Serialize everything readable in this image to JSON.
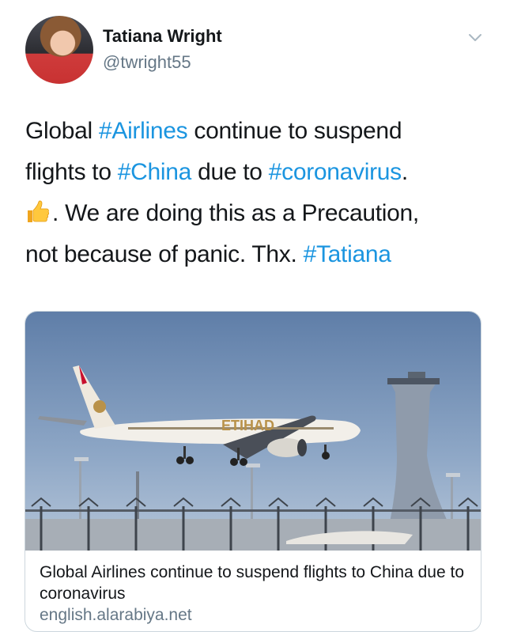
{
  "author": {
    "name": "Tatiana Wright",
    "handle": "@twright55"
  },
  "tweet": {
    "line1": {
      "a": "Global ",
      "tag1": "#Airlines",
      "b": " continue to suspend"
    },
    "line2": {
      "a": "flights to ",
      "tag1": "#China",
      "b": " due to ",
      "tag2": "#coronavirus",
      "c": "."
    },
    "line3": {
      "emoji": "thumbs-up-icon",
      "a": ". We are doing this as a Precaution,"
    },
    "line4": {
      "a": "not because of panic. Thx. ",
      "tag1": "#Tatiana"
    }
  },
  "card": {
    "title": "Global Airlines continue to suspend flights to China due to coronavirus",
    "domain": "english.alarabiya.net",
    "image": "airplane-landing-photo"
  },
  "colors": {
    "hashtag": "#1b95e0",
    "secondary_text": "#657786",
    "card_border": "#ccd6dd"
  }
}
